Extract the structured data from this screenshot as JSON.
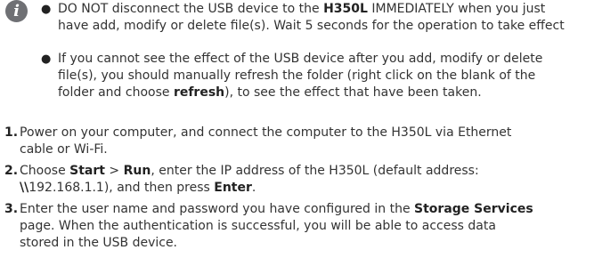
{
  "note": {
    "icon": "info-icon",
    "icon_glyph": "i",
    "icon_color": "#6f7074",
    "bullet_glyph": "●",
    "bullets": [
      {
        "lines": [
          [
            "DO NOT disconnect the USB device to the ",
            {
              "b": "H350L"
            },
            " IMMEDIATELY when you just"
          ],
          [
            "have add, modify or delete file(s). Wait 5 seconds for the operation to take effect"
          ]
        ]
      },
      {
        "lines": [
          [
            "If you cannot see the effect of the USB device after you add, modify or delete"
          ],
          [
            "file(s), you should manually refresh the folder (right click on the blank of the"
          ],
          [
            "folder and choose ",
            {
              "b": "refresh"
            },
            "), to see the effect that have been taken."
          ]
        ]
      }
    ]
  },
  "steps": [
    {
      "number": "1.",
      "lines": [
        [
          "Power on your computer, and connect the computer to the H350L via Ethernet"
        ],
        [
          "cable or Wi-Fi."
        ]
      ]
    },
    {
      "number": "2.",
      "lines": [
        [
          "Choose ",
          {
            "b": "Start"
          },
          " > ",
          {
            "b": "Run"
          },
          ", enter the IP address of the H350L (default address:"
        ],
        [
          {
            "b": "\\\\"
          },
          "192.168.1.1), and then press ",
          {
            "b": "Enter"
          },
          "."
        ]
      ]
    },
    {
      "number": "3.",
      "lines": [
        [
          "Enter the user name and password you have configured in the ",
          {
            "b": "Storage Services"
          }
        ],
        [
          "page. When the authentication is successful, you will be able to access data"
        ],
        [
          "stored in the USB device."
        ]
      ]
    }
  ]
}
